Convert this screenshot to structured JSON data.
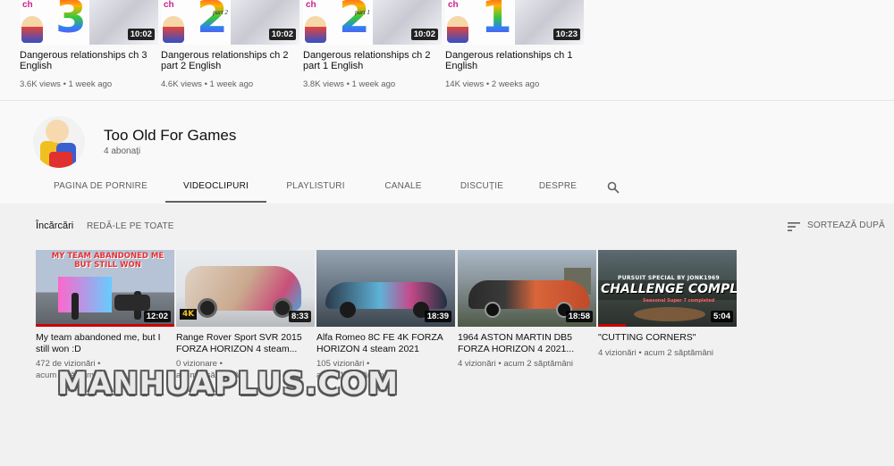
{
  "top_row": [
    {
      "ch_label": "ch",
      "digit": "3",
      "part_label": "",
      "title": "Dangerous relationships ch 3 English",
      "duration": "10:02",
      "meta": "3.6K views • 1 week ago"
    },
    {
      "ch_label": "ch",
      "digit": "2",
      "part_label": "part 2",
      "title": "Dangerous relationships ch 2 part 2 English",
      "duration": "10:02",
      "meta": "4.6K views • 1 week ago"
    },
    {
      "ch_label": "ch",
      "digit": "2",
      "part_label": "part 1",
      "title": "Dangerous relationships ch 2 part 1 English",
      "duration": "10:02",
      "meta": "3.8K views • 1 week ago"
    },
    {
      "ch_label": "ch",
      "digit": "1",
      "part_label": "",
      "title": "Dangerous relationships ch 1 English",
      "duration": "10:23",
      "meta": "14K views • 2 weeks ago"
    }
  ],
  "channel": {
    "name": "Too Old For Games",
    "subscribers": "4 abonați"
  },
  "tabs": [
    {
      "label": "PAGINA DE PORNIRE",
      "active": false
    },
    {
      "label": "VIDEOCLIPURI",
      "active": true
    },
    {
      "label": "PLAYLISTURI",
      "active": false
    },
    {
      "label": "CANALE",
      "active": false
    },
    {
      "label": "DISCUȚIE",
      "active": false
    },
    {
      "label": "DESPRE",
      "active": false
    }
  ],
  "uploads": {
    "label": "Încărcări",
    "play_all": "REDĂ-LE PE TOATE",
    "sort_label": "SORTEAZĂ DUPĂ"
  },
  "videos": [
    {
      "title": "My team abandoned me, but I still won :D",
      "views": "472 de vizionări",
      "age": "acum 1 săptămână",
      "duration": "12:02",
      "thumb_text": "MY TEAM ABANDONED ME BUT STILL WON",
      "watched_fraction": 1.0
    },
    {
      "title": "Range Rover Sport SVR 2015 FORZA HORIZON 4 steam...",
      "views": "0 vizionare",
      "age": "acum 1 săptămână",
      "duration": "8:33",
      "thumb_text": "4K",
      "watched_fraction": 0
    },
    {
      "title": "Alfa Romeo 8C FE 4K FORZA HORIZON 4 steam 2021",
      "views": "105 vizionări",
      "age": "acum 1 săptămână",
      "duration": "18:39",
      "thumb_text": "",
      "watched_fraction": 0
    },
    {
      "title": "1964 ASTON MARTIN DB5 FORZA HORIZON 4 2021...",
      "views": "4 vizionări",
      "age": "acum 2 săptămâni",
      "duration": "18:58",
      "thumb_text": "",
      "watched_fraction": 0
    },
    {
      "title": "\"CUTTING CORNERS\"",
      "views": "4 vizionări",
      "age": "acum 2 săptămâni",
      "duration": "5:04",
      "thumb_text_small": "PURSUIT SPECIAL BY JONK1969",
      "thumb_text_big": "CHALLENGE COMPLETE!",
      "thumb_text_sub": "Seasonal Super 7 completed",
      "watched_fraction": 0.2
    }
  ],
  "watermark": "MANHUAPLUS.COM",
  "colors": {
    "accent": "#cc0000",
    "text_secondary": "#606060",
    "background": "#f1f1f1"
  }
}
